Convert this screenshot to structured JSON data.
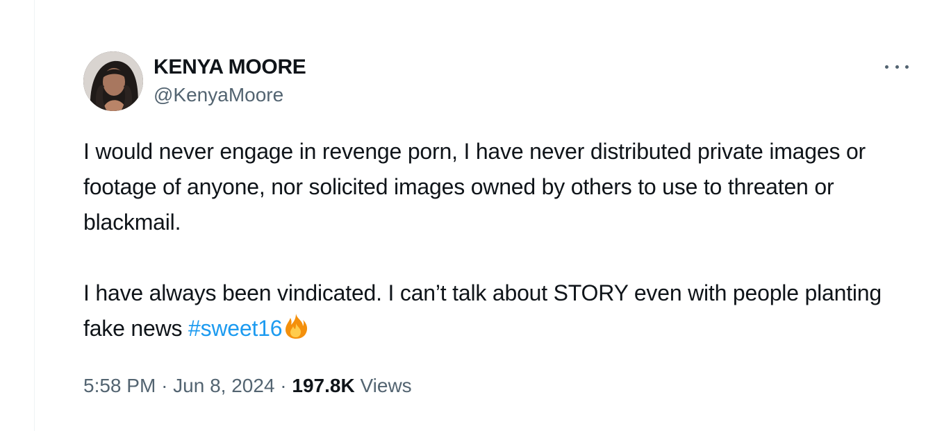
{
  "author": {
    "display_name": "KENYA MOORE",
    "handle": "@KenyaMoore"
  },
  "tweet": {
    "paragraph_1": "I would never engage in revenge porn, I have never distributed private images or footage of anyone, nor solicited images owned by others to use to threaten or blackmail.",
    "paragraph_2_text": "I have always been vindicated. I can’t talk about STORY even with people planting fake news ",
    "hashtag": "#sweet16",
    "emoji": "fire-emoji"
  },
  "meta": {
    "time": "5:58 PM",
    "separator": "·",
    "date": "Jun 8, 2024",
    "views_count": "197.8K",
    "views_label": "Views"
  },
  "colors": {
    "text": "#0f1419",
    "secondary": "#536471",
    "link": "#1d9bf0"
  }
}
